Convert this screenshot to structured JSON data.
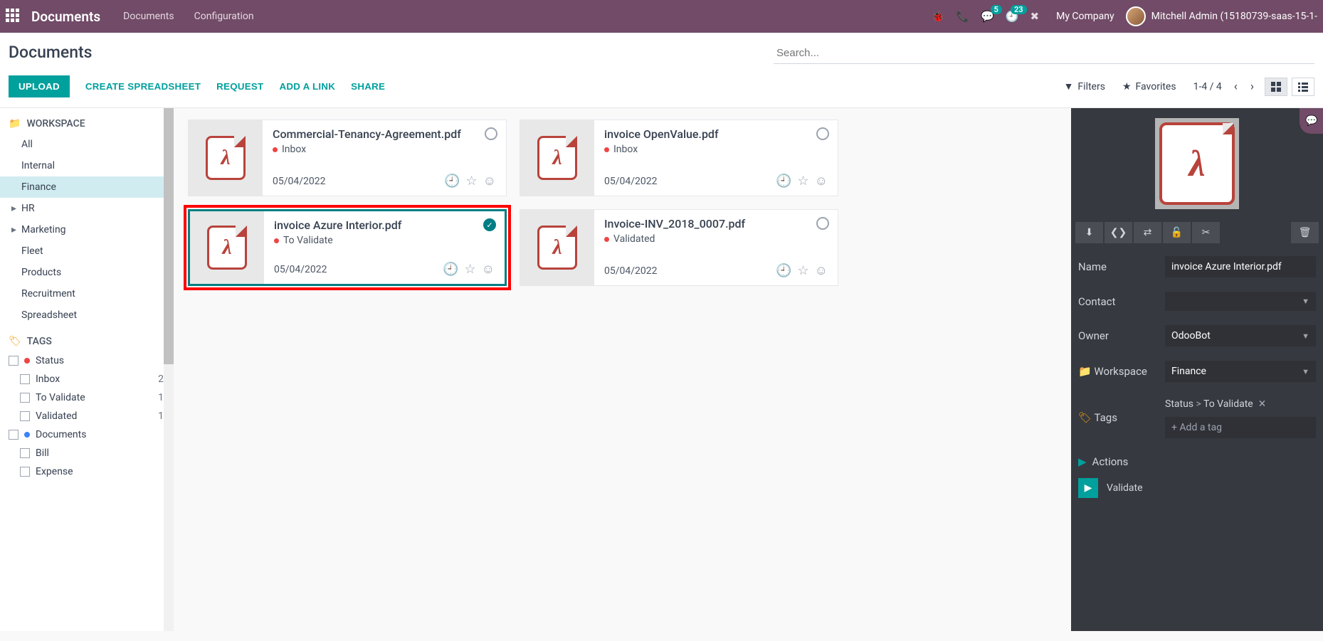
{
  "topbar": {
    "brand": "Documents",
    "nav": {
      "documents": "Documents",
      "configuration": "Configuration"
    },
    "badges": {
      "messages": "5",
      "activities": "23"
    },
    "company": "My Company",
    "user": "Mitchell Admin (15180739-saas-15-1-"
  },
  "header": {
    "title": "Documents",
    "search_placeholder": "Search..."
  },
  "ctrl": {
    "upload": "UPLOAD",
    "create_spreadsheet": "CREATE SPREADSHEET",
    "request": "REQUEST",
    "add_link": "ADD A LINK",
    "share": "SHARE",
    "filters": "Filters",
    "favorites": "Favorites",
    "pager": "1-4 / 4"
  },
  "sidebar": {
    "workspace_label": "WORKSPACE",
    "workspaces": [
      {
        "label": "All"
      },
      {
        "label": "Internal"
      },
      {
        "label": "Finance",
        "selected": true
      },
      {
        "label": "HR",
        "caret": true
      },
      {
        "label": "Marketing",
        "caret": true
      },
      {
        "label": "Fleet"
      },
      {
        "label": "Products"
      },
      {
        "label": "Recruitment"
      },
      {
        "label": "Spreadsheet"
      }
    ],
    "tags_label": "TAGS",
    "tag_groups": [
      {
        "label": "Status",
        "color": "#ef4444",
        "children": [
          {
            "label": "Inbox",
            "count": "2"
          },
          {
            "label": "To Validate",
            "count": "1"
          },
          {
            "label": "Validated",
            "count": "1"
          }
        ]
      },
      {
        "label": "Documents",
        "color": "#3b82f6",
        "children": [
          {
            "label": "Bill"
          },
          {
            "label": "Expense"
          }
        ]
      }
    ]
  },
  "cards": [
    {
      "title": "Commercial-Tenancy-Agreement.pdf",
      "status": "Inbox",
      "date": "05/04/2022",
      "selected": false
    },
    {
      "title": "invoice OpenValue.pdf",
      "status": "Inbox",
      "date": "05/04/2022",
      "selected": false
    },
    {
      "title": "invoice Azure Interior.pdf",
      "status": "To Validate",
      "date": "05/04/2022",
      "selected": true,
      "highlight": true
    },
    {
      "title": "Invoice-INV_2018_0007.pdf",
      "status": "Validated",
      "date": "05/04/2022",
      "selected": false
    }
  ],
  "detail": {
    "name_label": "Name",
    "name_value": "invoice Azure Interior.pdf",
    "contact_label": "Contact",
    "contact_value": "",
    "owner_label": "Owner",
    "owner_value": "OdooBot",
    "workspace_label": "Workspace",
    "workspace_value": "Finance",
    "tags_label": "Tags",
    "tags_display_group": "Status",
    "tags_display_value": "To Validate",
    "add_tag_placeholder": "+ Add a tag",
    "actions_label": "Actions",
    "validate_label": "Validate"
  }
}
